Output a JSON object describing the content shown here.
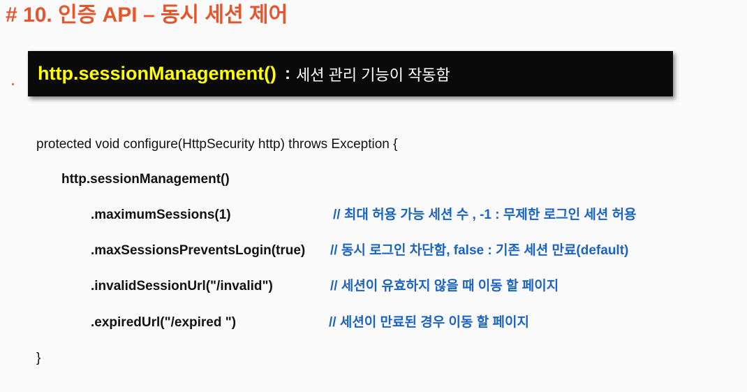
{
  "title": "# 10. 인증 API – 동시 세션 제어",
  "banner": {
    "method": "http.sessionManagement()",
    "separator": ":",
    "description": "세션 관리 기능이 작동함"
  },
  "code": {
    "signature": "protected void configure(HttpSecurity http) throws Exception {",
    "call": "http.sessionManagement()",
    "lines": [
      {
        "code": ".maximumSessions(1)",
        "comment": "// 최대 허용 가능 세션 수 , -1 : 무제한 로그인 세션 허용"
      },
      {
        "code": ".maxSessionsPreventsLogin(true)",
        "comment": "// 동시 로그인 차단함,  false : 기존 세션 만료(default)"
      },
      {
        "code": ".invalidSessionUrl(\"/invalid\")",
        "comment": "// 세션이 유효하지 않을 때 이동 할 페이지"
      },
      {
        "code": ".expiredUrl(\"/expired \")",
        "comment": "// 세션이 만료된 경우 이동 할 페이지"
      }
    ],
    "closing": "}"
  },
  "colors": {
    "title": "#e4572e",
    "banner_background": "#0a0a0a",
    "banner_method": "#ffff00",
    "comment": "#1a63c0"
  }
}
